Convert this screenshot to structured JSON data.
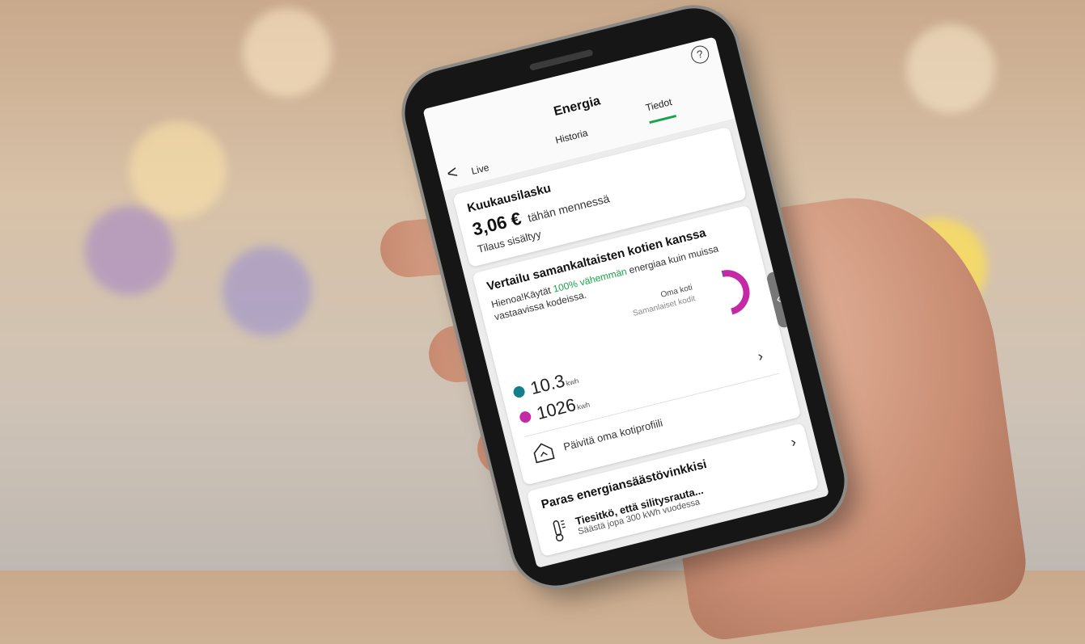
{
  "app": {
    "title": "Energia",
    "help_label": "?",
    "back_label": "<",
    "tabs": [
      {
        "label": "Live",
        "active": false
      },
      {
        "label": "Historia",
        "active": false
      },
      {
        "label": "Tiedot",
        "active": true
      }
    ]
  },
  "monthly_bill": {
    "heading": "Kuukausilasku",
    "amount": "3,06 €",
    "amount_suffix": "tähän mennessä",
    "note": "Tilaus sisältyy"
  },
  "comparison": {
    "heading": "Vertailu samankaltaisten kotien kanssa",
    "text_start": "Hienoa!Käytät ",
    "text_highlight": "100% vähemmän",
    "text_end": " energiaa kuin muissa vastaavissa kodeissa.",
    "legend_own": "Oma koti",
    "legend_similar": "Samanlaiset kodit",
    "own_value": "10.3",
    "own_unit": "kwh",
    "similar_value": "1026",
    "similar_unit": "kwh",
    "own_color": "#127f8a",
    "similar_color": "#c42aa6",
    "chevron": "›",
    "update_profile": "Päivitä oma kotiprofiili"
  },
  "tips": {
    "heading": "Paras energiansäästövinkkisi",
    "chevron": "›",
    "tip_title": "Tiesitkö, että silitysrauta...",
    "tip_sub": "Säästä jopa 300 kWh vuodessa"
  },
  "side_handle": "‹"
}
